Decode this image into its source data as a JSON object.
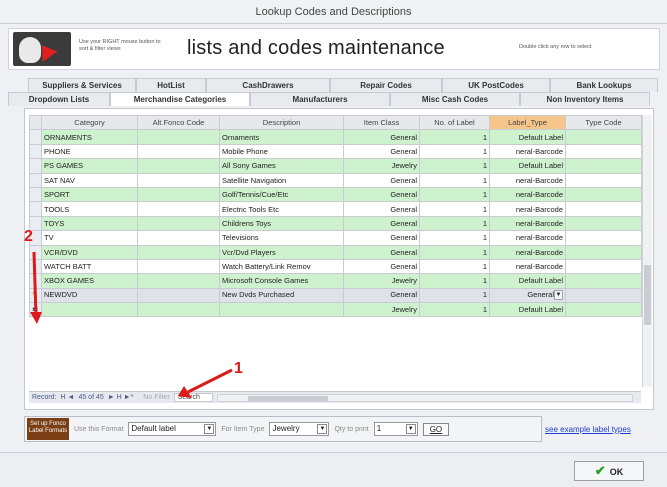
{
  "window": {
    "title": "Lookup Codes and Descriptions"
  },
  "banner": {
    "hint_left": "Use your RIGHT mouse button to sort & filter views",
    "title": "lists and codes maintenance",
    "hint_right": "Double click any row to select"
  },
  "tabs": {
    "row1": [
      "Suppliers & Services",
      "HotList",
      "CashDrawers",
      "Repair Codes",
      "UK PostCodes",
      "Bank Lookups"
    ],
    "row2": [
      "Dropdown Lists",
      "Merchandise Categories",
      "Manufacturers",
      "Misc Cash Codes",
      "Non Inventory Items"
    ]
  },
  "grid": {
    "columns": [
      "Category",
      "Alt.Fonco Code",
      "Description",
      "Item Class",
      "No. of Label",
      "Label_Type",
      "Type Code"
    ],
    "rows": [
      [
        "ORNAMENTS",
        "",
        "Ornaments",
        "General",
        "1",
        "Default Label",
        ""
      ],
      [
        "PHONE",
        "",
        "Mobile Phone",
        "General",
        "1",
        "neral-Barcode",
        ""
      ],
      [
        "PS GAMES",
        "",
        "All Sony Games",
        "Jewelry",
        "1",
        "Default Label",
        ""
      ],
      [
        "SAT NAV",
        "",
        "Satellite Navigation",
        "General",
        "1",
        "neral-Barcode",
        ""
      ],
      [
        "SPORT",
        "",
        "Golf/Tennis/Cue/Etc",
        "General",
        "1",
        "neral-Barcode",
        ""
      ],
      [
        "TOOLS",
        "",
        "Electric Tools Etc",
        "General",
        "1",
        "neral-Barcode",
        ""
      ],
      [
        "TOYS",
        "",
        "Childrens Toys",
        "General",
        "1",
        "neral-Barcode",
        ""
      ],
      [
        "TV",
        "",
        "Televisions",
        "General",
        "1",
        "neral-Barcode",
        ""
      ],
      [
        "VCR/DVD",
        "",
        "Vcr/Dvd Players",
        "General",
        "1",
        "neral-Barcode",
        ""
      ],
      [
        "WATCH BATT",
        "",
        "Watch Battery/Link Remov",
        "General",
        "1",
        "neral-Barcode",
        ""
      ],
      [
        "XBOX GAMES",
        "",
        "Microsoft Console Games",
        "Jewelry",
        "1",
        "Default Label",
        ""
      ],
      [
        "NEWDVD",
        "",
        "New Dvds Purchased",
        "General",
        "1",
        "General",
        ""
      ],
      [
        "",
        "",
        "",
        "Jewelry",
        "1",
        "Default Label",
        ""
      ]
    ]
  },
  "nav": {
    "record_label": "Record:",
    "buttons": "H ◄",
    "position": "45 of 45",
    "buttons2": "► H ►*",
    "no_filter": "No Filter",
    "search": "Search"
  },
  "bottom": {
    "setup_button": "Set up Fonco Label Formats",
    "format_label": "Use this Format",
    "format_value": "Default label",
    "item_type_label": "For Item Type",
    "item_type_value": "Jewelry",
    "qty_label": "Qty to print",
    "qty_value": "1",
    "go_label": "GO",
    "see_link": "see example label types"
  },
  "ok_label": "OK",
  "annotations": {
    "one": "1",
    "two": "2"
  },
  "colors": {
    "row_green": "#cdf2cd",
    "label_type_header": "#f6c58a",
    "arrow": "#dd1a1a",
    "setup_button": "#7b3f15"
  }
}
